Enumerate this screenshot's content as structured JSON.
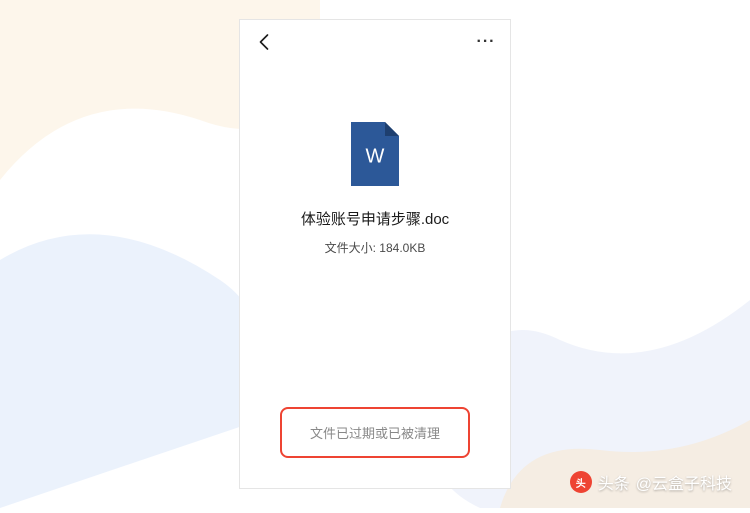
{
  "header": {
    "more_label": "···"
  },
  "file": {
    "icon_letter": "W",
    "name": "体验账号申请步骤.doc",
    "size_label": "文件大小: 184.0KB"
  },
  "status": {
    "expired_text": "文件已过期或已被清理"
  },
  "watermark": {
    "prefix": "头条",
    "handle": "@云盒子科技"
  }
}
